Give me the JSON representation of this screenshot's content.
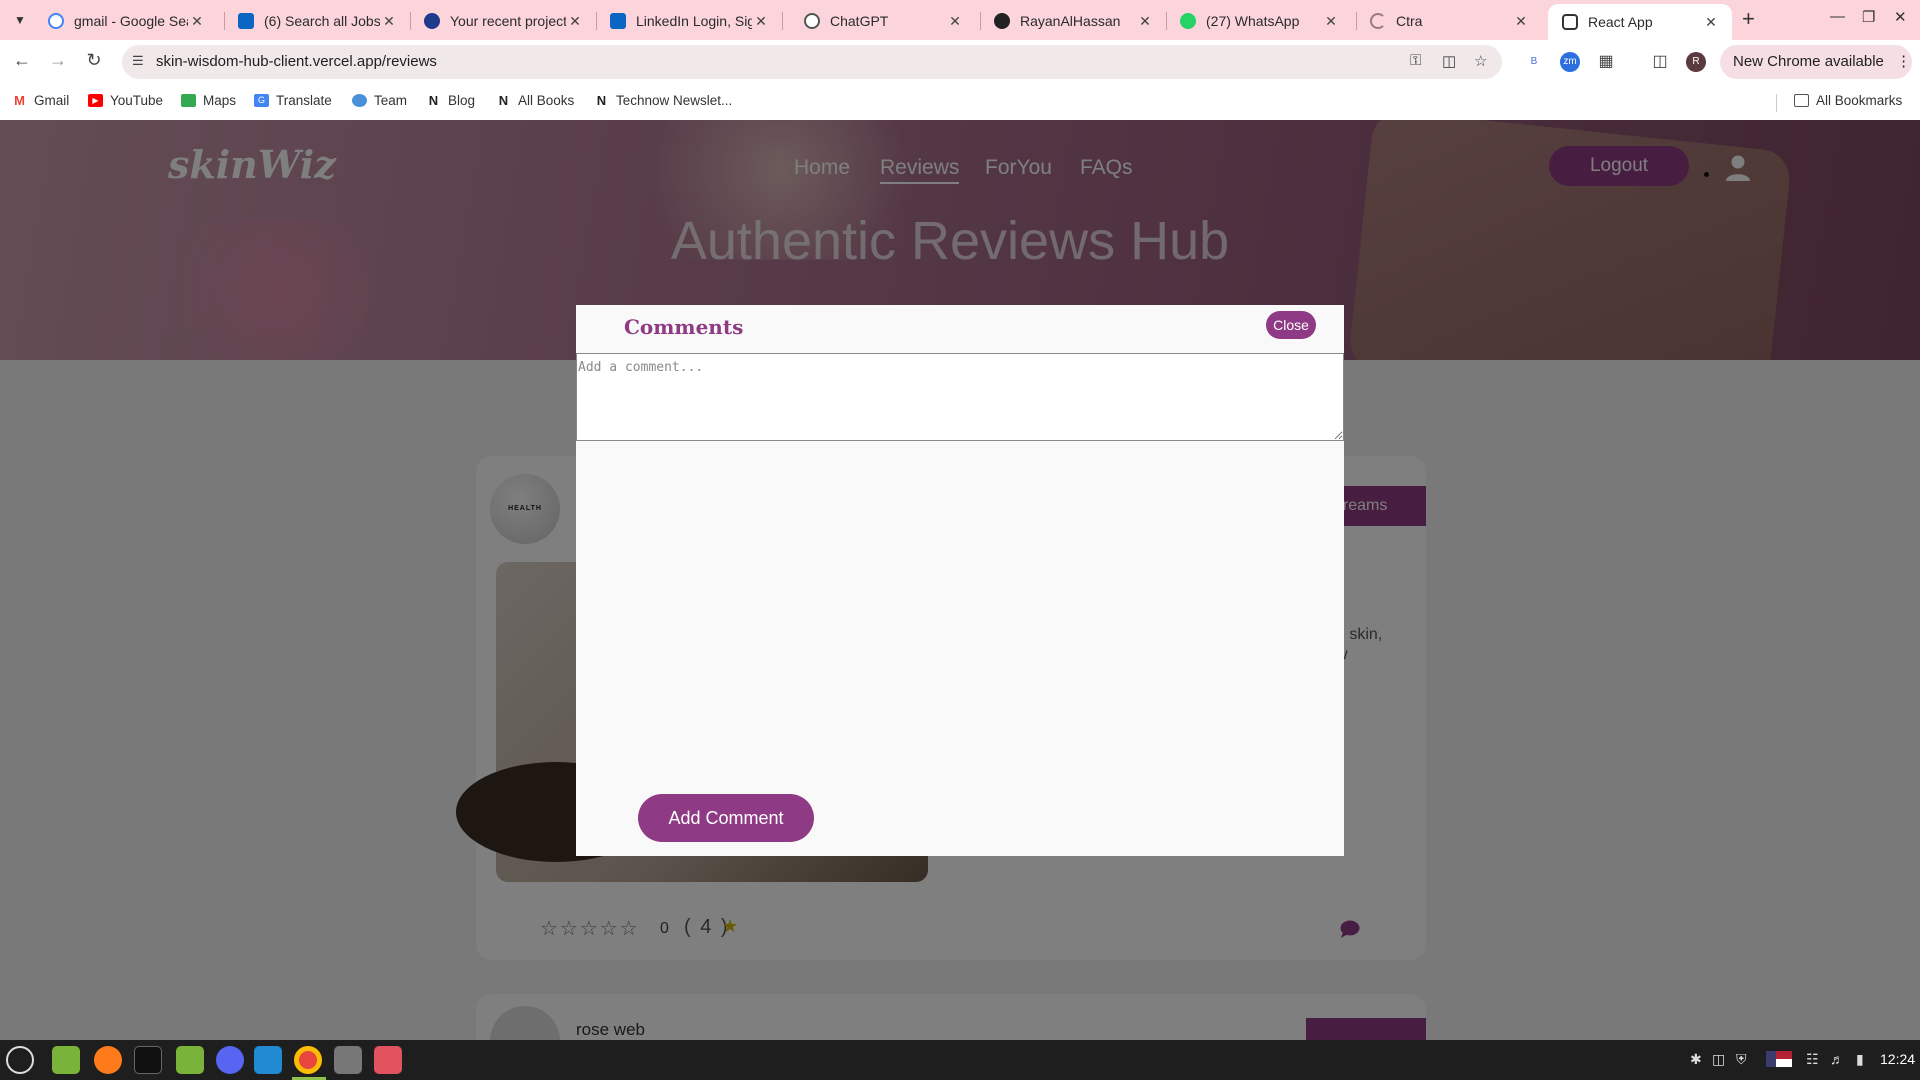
{
  "browser": {
    "tabs": [
      {
        "title": "gmail - Google Sear",
        "icon": "google-icon",
        "color": "#4285f4"
      },
      {
        "title": "(6) Search all Jobs |",
        "icon": "linkedin-icon",
        "color": "#0a66c2"
      },
      {
        "title": "Your recent projects",
        "icon": "projects-icon",
        "color": "#1f3a8a"
      },
      {
        "title": "LinkedIn Login, Sign",
        "icon": "linkedin-icon",
        "color": "#0a66c2"
      },
      {
        "title": "ChatGPT",
        "icon": "chatgpt-icon",
        "color": "#555555"
      },
      {
        "title": "RayanAlHassan",
        "icon": "github-icon",
        "color": "#222222"
      },
      {
        "title": "(27) WhatsApp",
        "icon": "whatsapp-icon",
        "color": "#25d366"
      },
      {
        "title": "Ctra",
        "icon": "loading-icon",
        "color": "#9a7a80"
      },
      {
        "title": "React App",
        "icon": "react-icon",
        "color": "#333333",
        "active": true
      }
    ],
    "new_tab": "+",
    "url": "skin-wisdom-hub-client.vercel.app/reviews",
    "new_chrome": "New Chrome available",
    "profile_initial": "R",
    "ext_b": "B",
    "ext_zm": "zm",
    "bookmarks": [
      {
        "label": "Gmail",
        "icon": "gmail-icon",
        "color": "#ea4335"
      },
      {
        "label": "YouTube",
        "icon": "youtube-icon",
        "color": "#ff0000"
      },
      {
        "label": "Maps",
        "icon": "maps-icon",
        "color": "#34a853"
      },
      {
        "label": "Translate",
        "icon": "translate-icon",
        "color": "#4285f4"
      },
      {
        "label": "Team",
        "icon": "team-icon",
        "color": "#4a90d9"
      },
      {
        "label": "Blog",
        "icon": "notion-icon",
        "color": "#222222"
      },
      {
        "label": "All Books",
        "icon": "notion-icon",
        "color": "#222222"
      },
      {
        "label": "Technow Newslet...",
        "icon": "notion-icon",
        "color": "#222222"
      }
    ],
    "all_bookmarks": "All Bookmarks"
  },
  "site": {
    "logo": "skinWiz",
    "nav": [
      "Home",
      "Reviews",
      "ForYou",
      "FAQs"
    ],
    "active_nav": "Reviews",
    "logout": "Logout",
    "hero_title": "Authentic Reviews Hub",
    "accent": "#8e3a84"
  },
  "card": {
    "avatar_text": "HEALTH",
    "tag": "e Creams",
    "text_line1": "e skin,",
    "text_line2": "w",
    "stars": "☆☆☆☆☆",
    "star_count": "0",
    "rating": "( 4 )",
    "rating_star": "★"
  },
  "card2": {
    "name": "rose web"
  },
  "modal": {
    "title": "Comments",
    "close": "Close",
    "comment_placeholder": "Add a comment...",
    "comment_value": "",
    "add_button": "Add Comment"
  },
  "taskbar": {
    "clock": "12:24"
  }
}
